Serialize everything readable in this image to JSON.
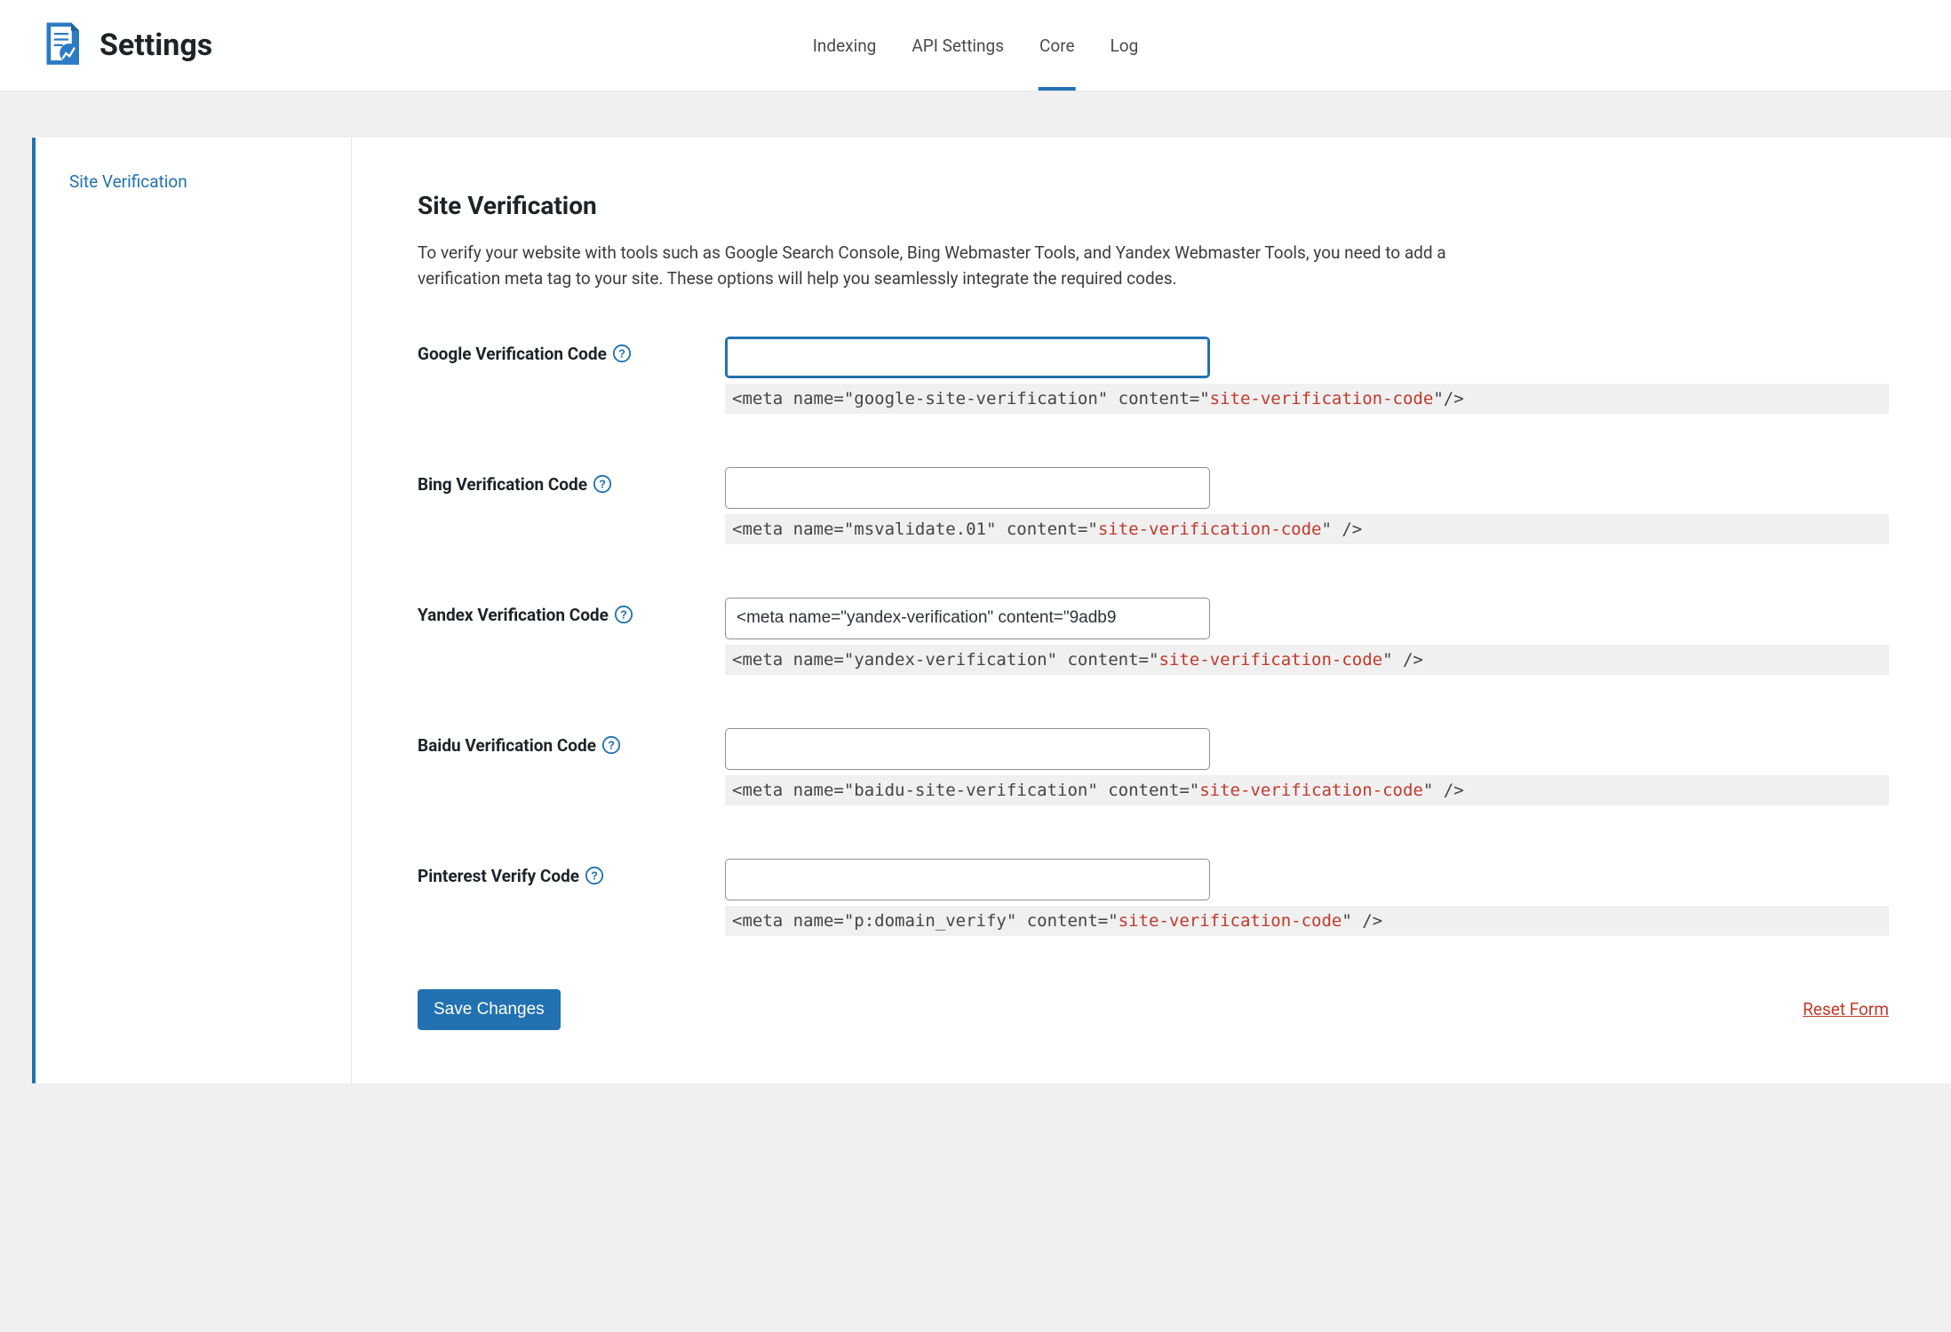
{
  "header": {
    "title": "Settings",
    "tabs": [
      {
        "label": "Indexing",
        "active": false
      },
      {
        "label": "API Settings",
        "active": false
      },
      {
        "label": "Core",
        "active": true
      },
      {
        "label": "Log",
        "active": false
      }
    ]
  },
  "sidebar": {
    "items": [
      {
        "label": "Site Verification",
        "active": true
      }
    ]
  },
  "section": {
    "title": "Site Verification",
    "description": "To verify your website with tools such as Google Search Console, Bing Webmaster Tools, and Yandex Webmaster Tools, you need to add a verification meta tag to your site. These options will help you seamlessly integrate the required codes."
  },
  "fields": {
    "google": {
      "label": "Google Verification Code",
      "value": "",
      "hint_prefix": "<meta name=\"google-site-verification\" content=\"",
      "hint_code": "site-verification-code",
      "hint_suffix": "\"/>"
    },
    "bing": {
      "label": "Bing Verification Code",
      "value": "",
      "hint_prefix": "<meta name=\"msvalidate.01\" content=\"",
      "hint_code": "site-verification-code",
      "hint_suffix": "\" />"
    },
    "yandex": {
      "label": "Yandex Verification Code",
      "value": "<meta name=\"yandex-verification\" content=\"9adb9",
      "hint_prefix": "<meta name=\"yandex-verification\" content=\"",
      "hint_code": "site-verification-code",
      "hint_suffix": "\" />"
    },
    "baidu": {
      "label": "Baidu Verification Code",
      "value": "",
      "hint_prefix": "<meta name=\"baidu-site-verification\" content=\"",
      "hint_code": "site-verification-code",
      "hint_suffix": "\" />"
    },
    "pinterest": {
      "label": "Pinterest Verify Code",
      "value": "",
      "hint_prefix": "<meta name=\"p:domain_verify\" content=\"",
      "hint_code": "site-verification-code",
      "hint_suffix": "\" />"
    }
  },
  "actions": {
    "save_label": "Save Changes",
    "reset_label": "Reset Form"
  }
}
